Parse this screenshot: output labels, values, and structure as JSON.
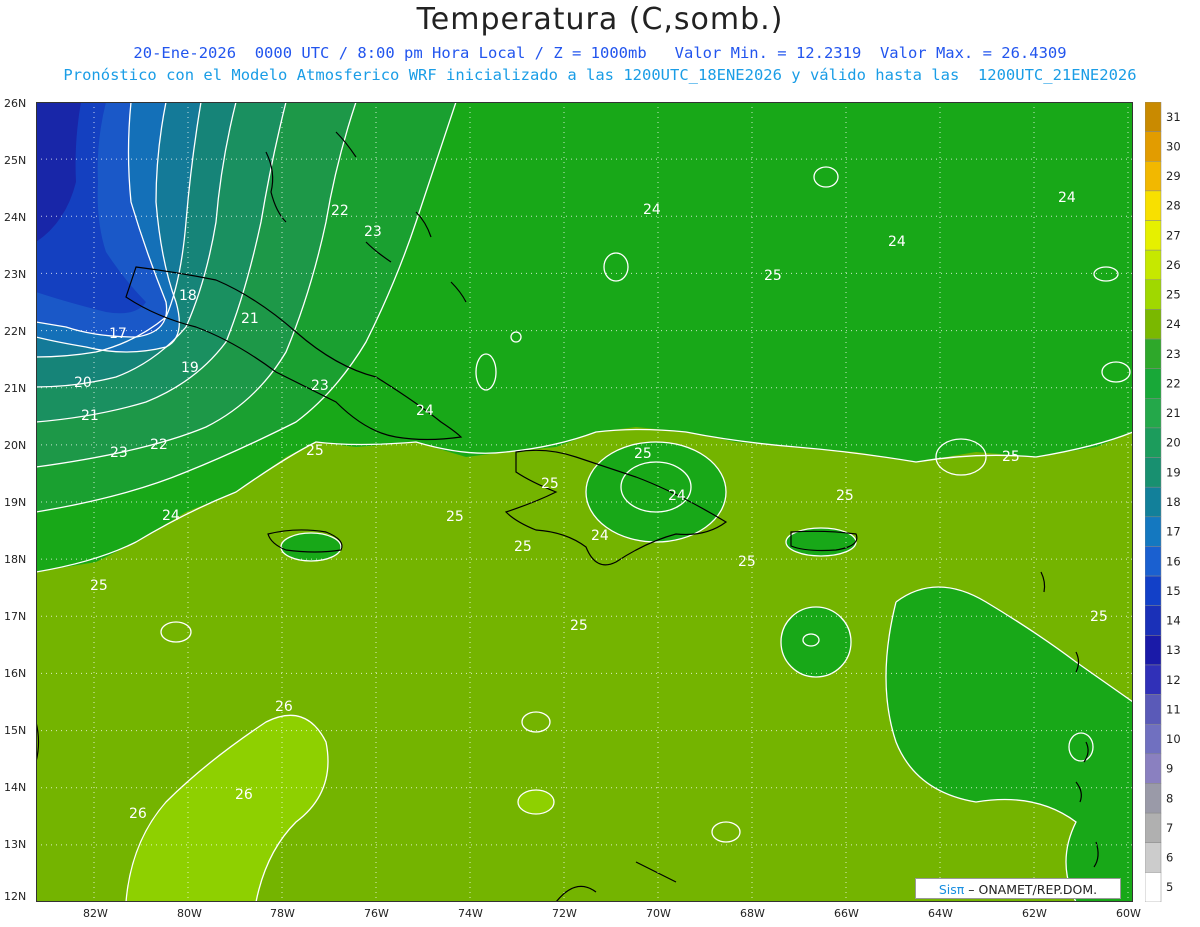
{
  "header": {
    "title": "Temperatura (C,somb.)",
    "subtitle1": "20-Ene-2026  0000 UTC / 8:00 pm Hora Local / Z = 1000mb   Valor Min. = 12.2319  Valor Max. = 26.4309",
    "subtitle2": "Pronóstico con el Modelo Atmosferico WRF inicializado a las 1200UTC_18ENE2026 y válido hasta las  1200UTC_21ENE2026"
  },
  "axes": {
    "lat_labels": [
      "26N",
      "25N",
      "24N",
      "23N",
      "22N",
      "21N",
      "20N",
      "19N",
      "18N",
      "17N",
      "16N",
      "15N",
      "14N",
      "13N",
      "12N"
    ],
    "lon_labels": [
      "82W",
      "80W",
      "78W",
      "76W",
      "74W",
      "72W",
      "70W",
      "68W",
      "66W",
      "64W",
      "62W",
      "60W"
    ]
  },
  "contour_labels": [
    "22",
    "23",
    "18",
    "21",
    "17",
    "19",
    "20",
    "21",
    "23",
    "22",
    "24",
    "23",
    "24",
    "25",
    "25",
    "25",
    "24",
    "25",
    "25",
    "25",
    "24",
    "24",
    "24",
    "24",
    "25",
    "25",
    "25",
    "25",
    "25",
    "25",
    "26",
    "26",
    "26"
  ],
  "colorbar": {
    "levels": [
      "31",
      "30",
      "29",
      "28",
      "27",
      "26",
      "25",
      "24",
      "23",
      "22",
      "21",
      "20",
      "19",
      "18",
      "17",
      "16",
      "15",
      "14",
      "13",
      "12",
      "11",
      "10",
      "9",
      "8",
      "7",
      "6",
      "5"
    ],
    "colors": [
      "#c98a00",
      "#e29c00",
      "#f2b800",
      "#f8e000",
      "#e6f000",
      "#c6e800",
      "#a0d800",
      "#7ab800",
      "#2ea82a",
      "#18a838",
      "#24a84a",
      "#1c9c5c",
      "#189070",
      "#12809a",
      "#1478c0",
      "#1a60d0",
      "#1240c8",
      "#1a30b8",
      "#1a1aa8",
      "#3030b8",
      "#5a5ab8",
      "#7070c0",
      "#8a80c0",
      "#9a9aa8",
      "#b0b0b0",
      "#cccccc",
      "#ffffff"
    ]
  },
  "credit": {
    "brand": "Sisπ",
    "text": " – ONAMET/REP.DOM."
  }
}
